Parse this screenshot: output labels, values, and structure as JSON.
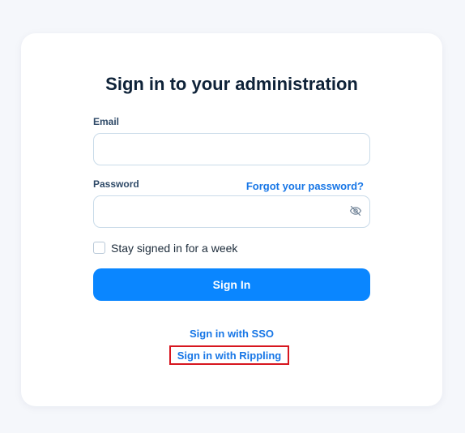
{
  "page": {
    "title": "Sign in to your administration"
  },
  "form": {
    "email_label": "Email",
    "email_value": "",
    "email_placeholder": "",
    "password_label": "Password",
    "password_value": "",
    "password_placeholder": "",
    "forgot_link": "Forgot your password?",
    "stay_signed_in_label": "Stay signed in for a week",
    "stay_signed_in_checked": false,
    "submit_label": "Sign In"
  },
  "alt_signin": {
    "sso_label": "Sign in with SSO",
    "rippling_label": "Sign in with Rippling"
  },
  "icons": {
    "password_toggle": "eye-off-icon"
  },
  "colors": {
    "accent": "#0a86ff",
    "link": "#1776e6",
    "title": "#0e2238",
    "highlight_border": "#d7161f"
  }
}
